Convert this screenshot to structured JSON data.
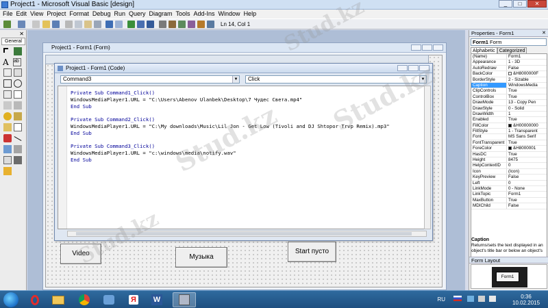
{
  "window": {
    "title": "Project1 - Microsoft Visual Basic [design]",
    "btn_min": "_",
    "btn_max": "□",
    "btn_close": "✕"
  },
  "menu": [
    "File",
    "Edit",
    "View",
    "Project",
    "Format",
    "Debug",
    "Run",
    "Query",
    "Diagram",
    "Tools",
    "Add-Ins",
    "Window",
    "Help"
  ],
  "toolbar": {
    "position": "Ln 14, Col 1"
  },
  "toolbox": {
    "tab": "General",
    "close": "✕",
    "icon_label": "A",
    "icon_ab": "ab"
  },
  "designer": {
    "title": "Project1 - Form1 (Form)"
  },
  "form_buttons": {
    "video": "Video",
    "music": "Музыка",
    "start": "Start пусто"
  },
  "code_window": {
    "title": "Project1 - Form1 (Code)",
    "object": "Command3",
    "procedure": "Click",
    "lines": [
      "Private Sub Command1_Click()",
      "WindowsMediaPlayer1.URL = \"C:\\Users\\Abenov Ulanbek\\Desktop\\7 Чудес Света.mp4\"",
      "End Sub",
      "",
      "Private Sub Command2_Click()",
      "WindowsMediaPlayer1.URL = \"C:\\My downloads\\Music\\Lil Jon - Get Low (Tivoli and DJ Shtopor Trvp Remix).mp3\"",
      "End Sub",
      "",
      "Private Sub Command3_Click()",
      "WindowsMediaPlayer1.URL = \"c:\\windows\\media\\notify.wav\"",
      "End Sub"
    ]
  },
  "properties": {
    "header": "Properties - Form1",
    "object": "Form1",
    "object_type": "Form",
    "tabs": [
      "Alphabetic",
      "Categorized"
    ],
    "rows": [
      [
        "(Name)",
        "Form1"
      ],
      [
        "Appearance",
        "1 - 3D"
      ],
      [
        "AutoRedraw",
        "False"
      ],
      [
        "BackColor",
        "&H8000000F"
      ],
      [
        "BorderStyle",
        "2 - Sizable"
      ],
      [
        "Caption",
        "WindowsMedia"
      ],
      [
        "ClipControls",
        "True"
      ],
      [
        "ControlBox",
        "True"
      ],
      [
        "DrawMode",
        "13 - Copy Pen"
      ],
      [
        "DrawStyle",
        "0 - Solid"
      ],
      [
        "DrawWidth",
        "1"
      ],
      [
        "Enabled",
        "True"
      ],
      [
        "FillColor",
        "&H00000000"
      ],
      [
        "FillStyle",
        "1 - Transparent"
      ],
      [
        "Font",
        "MS Sans Serif"
      ],
      [
        "FontTransparent",
        "True"
      ],
      [
        "ForeColor",
        "&H8000001"
      ],
      [
        "HasDC",
        "True"
      ],
      [
        "Height",
        "8475"
      ],
      [
        "HelpContextID",
        "0"
      ],
      [
        "Icon",
        "(Icon)"
      ],
      [
        "KeyPreview",
        "False"
      ],
      [
        "Left",
        "0"
      ],
      [
        "LinkMode",
        "0 - None"
      ],
      [
        "LinkTopic",
        "Form1"
      ],
      [
        "MaxButton",
        "True"
      ],
      [
        "MDIChild",
        "False"
      ]
    ],
    "selected": "Caption",
    "desc_title": "Caption",
    "desc_text": "Returns/sets the text displayed in an object's title bar or below an object's"
  },
  "form_layout": {
    "header": "Form Layout",
    "form_label": "Form1"
  },
  "taskbar": {
    "lang": "RU",
    "time": "0:36",
    "date": "10.02.2015"
  },
  "watermark": "Stud.kz",
  "colors": {
    "selection": "#3399ff",
    "keyword": "#000099",
    "taskbar": "#1e4f80"
  }
}
